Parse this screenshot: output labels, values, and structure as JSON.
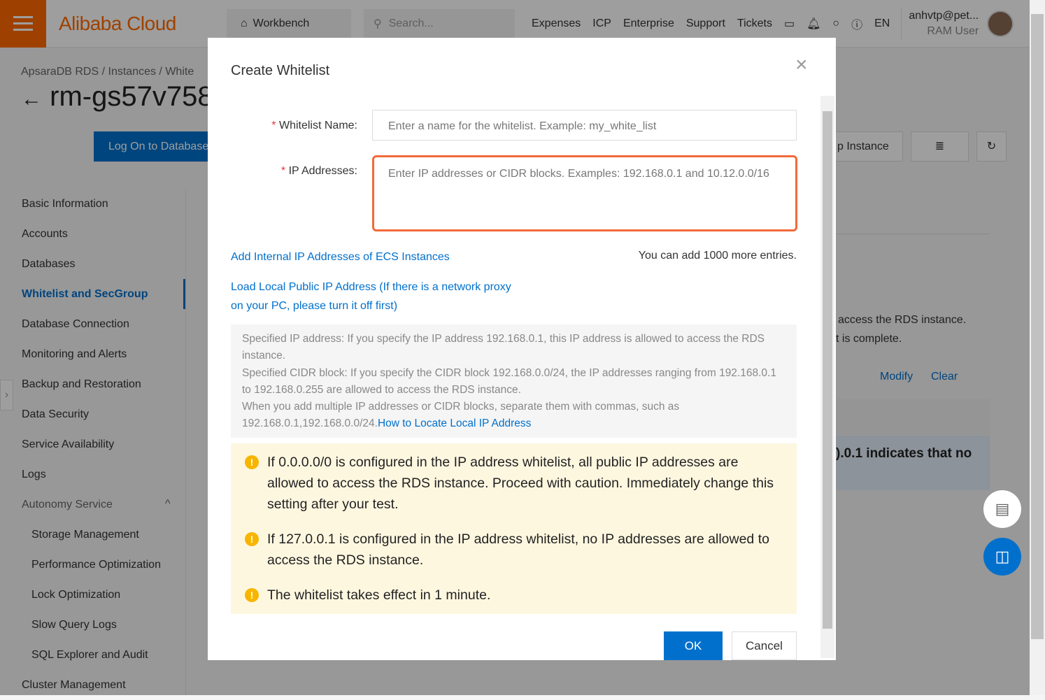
{
  "header": {
    "brand": "Alibaba Cloud",
    "workbench": "Workbench",
    "search_placeholder": "Search...",
    "nav": [
      "Expenses",
      "ICP",
      "Enterprise",
      "Support",
      "Tickets"
    ],
    "lang": "EN",
    "user": "anhvtp@pet...",
    "role": "RAM User"
  },
  "breadcrumb": [
    "ApsaraDB RDS",
    "Instances",
    "White"
  ],
  "instance_title": "rm-gs57v758",
  "toolbar": {
    "logon": "Log On to Database",
    "instance_btn": "p Instance"
  },
  "sidebar": {
    "items": [
      "Basic Information",
      "Accounts",
      "Databases",
      "Whitelist and SecGroup",
      "Database Connection",
      "Monitoring and Alerts",
      "Backup and Restoration",
      "Data Security",
      "Service Availability",
      "Logs",
      "Autonomy Service",
      "Storage Management",
      "Performance Optimization",
      "Lock Optimization",
      "Slow Query Logs",
      "SQL Explorer and Audit",
      "Cluster Management"
    ]
  },
  "background": {
    "line1": "access the RDS instance.",
    "line2": "t is complete.",
    "modify": "Modify",
    "clear": "Clear",
    "note": ").0.1 indicates that no"
  },
  "dialog": {
    "title": "Create Whitelist",
    "name_label": "Whitelist Name:",
    "name_placeholder": "Enter a name for the whitelist. Example: my_white_list",
    "ip_label": "IP Addresses:",
    "ip_placeholder": "Enter IP addresses or CIDR blocks. Examples: 192.168.0.1 and 10.12.0.0/16",
    "add_ecs": "Add Internal IP Addresses of ECS Instances",
    "remaining": "You can add 1000 more entries.",
    "load_local": "Load Local Public IP Address (If there is a network proxy on your PC, please turn it off first)",
    "info": [
      "Specified IP address: If you specify the IP address 192.168.0.1, this IP address is allowed to access the RDS instance.",
      "Specified CIDR block: If you specify the CIDR block 192.168.0.0/24, the IP addresses ranging from 192.168.0.1 to 192.168.0.255 are allowed to access the RDS instance.",
      "When you add multiple IP addresses or CIDR blocks, separate them with commas, such as 192.168.0.1,192.168.0.0/24."
    ],
    "info_link": "How to Locate Local IP Address",
    "warnings": [
      "If 0.0.0.0/0 is configured in the IP address whitelist, all public IP addresses are allowed to access the RDS instance. Proceed with caution. Immediately change this setting after your test.",
      "If 127.0.0.1 is configured in the IP address whitelist, no IP addresses are allowed to access the RDS instance.",
      "The whitelist takes effect in 1 minute."
    ],
    "ok": "OK",
    "cancel": "Cancel"
  },
  "colors": {
    "brand": "#ff6a00",
    "primary": "#0070cc",
    "focus_border": "#f26a3a",
    "warning_bg": "#fef7e0"
  }
}
